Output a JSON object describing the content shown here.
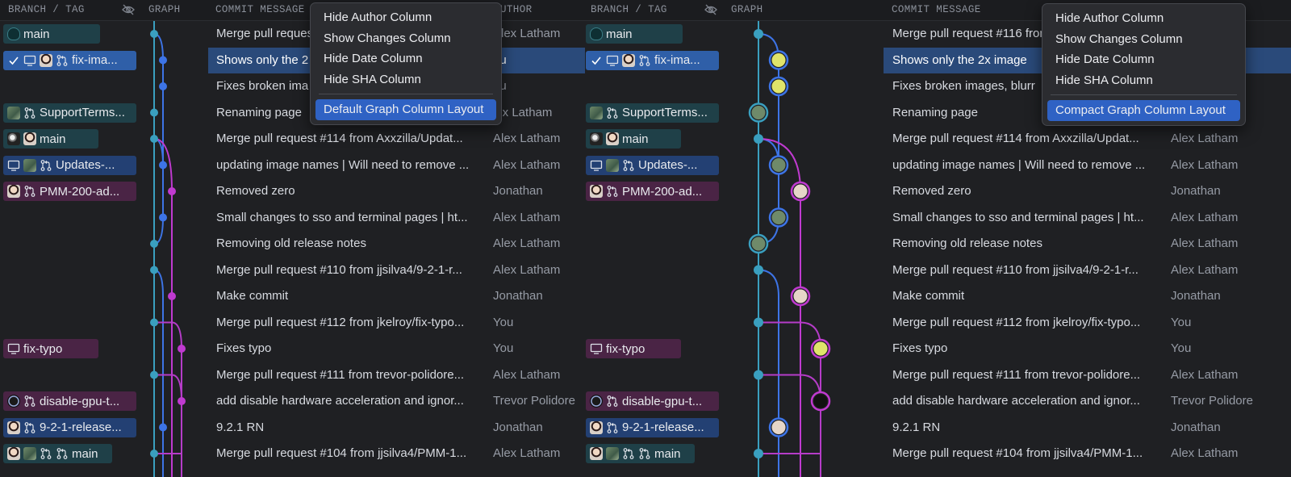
{
  "headers": {
    "branch_tag": "BRANCH / TAG",
    "graph": "GRAPH",
    "commit_message": "COMMIT MESSAGE",
    "author_partial": "UTHOR",
    "author": "AUTHOR"
  },
  "rows": [
    {
      "message": "Merge pull request #116 from",
      "author": "Alex Latham",
      "ref": "main"
    },
    {
      "message": "Shows only the 2x image",
      "author": "You",
      "ref": "fix-image-size"
    },
    {
      "message": "Fixes broken images, blurry images",
      "author": "You",
      "ref": ""
    },
    {
      "message": "Renaming page",
      "author": "Alex Latham",
      "ref": "SupportTerms-page"
    },
    {
      "message": "Merge pull request #114 from Axxzilla/Updates-images",
      "author": "Alex Latham",
      "ref": "main"
    },
    {
      "message": "updating image names | Will need to remove old images",
      "author": "Alex Latham",
      "ref": "Updates-images"
    },
    {
      "message": "Removed zero",
      "author": "Jonathan",
      "ref": "PMM-200-add-zero"
    },
    {
      "message": "Small changes to sso and terminal pages | https",
      "author": "Alex Latham",
      "ref": ""
    },
    {
      "message": "Removing old release notes",
      "author": "Alex Latham",
      "ref": ""
    },
    {
      "message": "Merge pull request #110 from jjsilva4/9-2-1-release",
      "author": "Alex Latham",
      "ref": ""
    },
    {
      "message": "Make commit",
      "author": "Jonathan",
      "ref": ""
    },
    {
      "message": "Merge pull request #112 from jkelroy/fix-typo-page",
      "author": "You",
      "ref": ""
    },
    {
      "message": "Fixes typo",
      "author": "You",
      "ref": "fix-typo"
    },
    {
      "message": "Merge pull request #111 from trevor-polidore/disable-gpu",
      "author": "Alex Latham",
      "ref": ""
    },
    {
      "message": "add disable hardware acceleration and ignore gpu",
      "author": "Trevor Polidore",
      "ref": "disable-gpu-toggle"
    },
    {
      "message": "9.2.1 RN",
      "author": "Jonathan",
      "ref": "9-2-1-release-notes"
    },
    {
      "message": "Merge pull request #104 from jjsilva4/PMM-1234",
      "author": "Alex Latham",
      "ref": "main"
    }
  ],
  "left_refs": [
    "main",
    "fix-ima...",
    "SupportTerms...",
    "main",
    "Updates-...",
    "PMM-200-ad...",
    "fix-typo",
    "disable-gpu-t...",
    "9-2-1-release...",
    "main"
  ],
  "left_menu": {
    "items": [
      "Hide Author Column",
      "Show Changes Column",
      "Hide Date Column",
      "Hide SHA Column"
    ],
    "layout_option": "Default Graph Column Layout"
  },
  "right_menu": {
    "items": [
      "Hide Author Column",
      "Show Changes Column",
      "Hide Date Column",
      "Hide SHA Column"
    ],
    "layout_option": "Compact Graph Column Layout"
  },
  "left_messages": [
    "Merge pull request",
    "Shows only the 2",
    "Fixes broken ima",
    "Renaming page",
    "Merge pull request #114 from Axxzilla/Updat...",
    "updating image names | Will need to remove ...",
    "Removed zero",
    "Small changes to sso and terminal pages | ht...",
    "Removing old release notes",
    "Merge pull request #110 from jjsilva4/9-2-1-r...",
    "Make commit",
    "Merge pull request #112 from jkelroy/fix-typo...",
    "Fixes typo",
    "Merge pull request #111 from trevor-polidore...",
    "add disable hardware acceleration and ignor...",
    "9.2.1 RN",
    "Merge pull request #104 from jjsilva4/PMM-1..."
  ],
  "left_authors": [
    "Alex Latham",
    "ou",
    "ou",
    "lex Latham",
    "Alex Latham",
    "Alex Latham",
    "Jonathan",
    "Alex Latham",
    "Alex Latham",
    "Alex Latham",
    "Jonathan",
    "You",
    "You",
    "Alex Latham",
    "Trevor Polidore",
    "Jonathan",
    "Alex Latham"
  ],
  "right_messages": [
    "Merge pull request #116 from",
    "Shows only the 2x image",
    "Fixes broken images, blurr",
    "Renaming page",
    "Merge pull request #114 from Axxzilla/Updat...",
    "updating image names | Will need to remove ...",
    "Removed zero",
    "Small changes to sso and terminal pages | ht...",
    "Removing old release notes",
    "Merge pull request #110 from jjsilva4/9-2-1-r...",
    "Make commit",
    "Merge pull request #112 from jkelroy/fix-typo...",
    "Fixes typo",
    "Merge pull request #111 from trevor-polidore...",
    "add disable hardware acceleration and ignor...",
    "9.2.1 RN",
    "Merge pull request #104 from jjsilva4/PMM-1..."
  ],
  "right_authors": [
    "",
    "",
    "",
    "",
    "Alex Latham",
    "Alex Latham",
    "Jonathan",
    "Alex Latham",
    "Alex Latham",
    "Alex Latham",
    "Jonathan",
    "You",
    "You",
    "Alex Latham",
    "Trevor Polidore",
    "Jonathan",
    "Alex Latham"
  ],
  "colors": {
    "teal": "#3a9fbf",
    "blue": "#3d74e6",
    "purple": "#c03ad0",
    "magenta": "#b53cc8",
    "selection": "#2a4a7a",
    "menu_highlight": "#2f62c4"
  }
}
